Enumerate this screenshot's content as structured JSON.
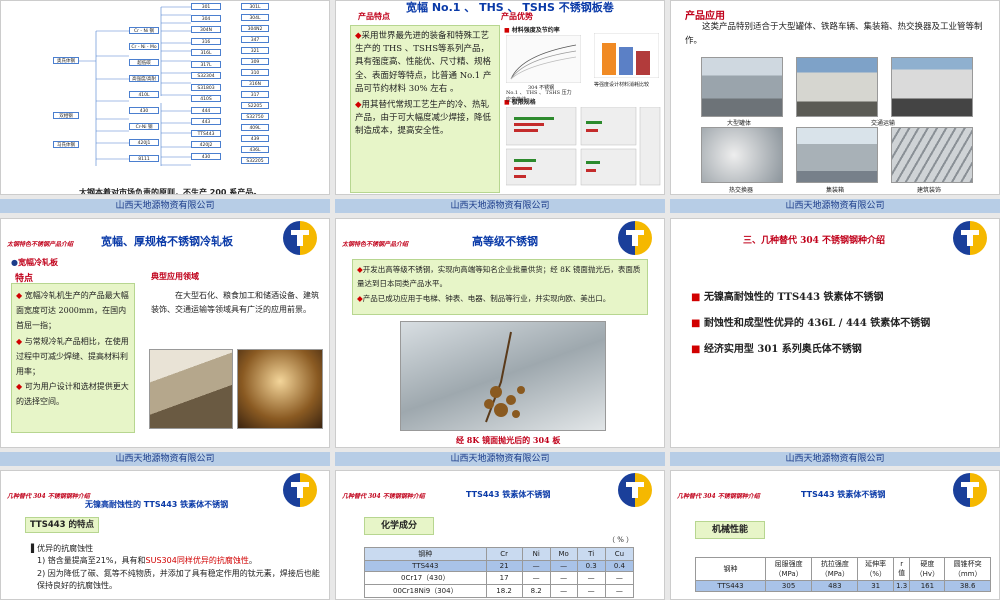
{
  "footer_text": "山西天地源物资有限公司",
  "s1": {
    "caption": "太钢本着对市场负责的原则，不生产 200 系产品。",
    "tree_left": [
      "奥氏体钢",
      "双相钢",
      "马氏体钢"
    ],
    "tree_mid": [
      "Cr - Ni 钢",
      "Cr - Ni - Mo 钢",
      "超低碳",
      "高强度/高耐蚀",
      "410L",
      "430",
      "Cr-Ni 钢",
      "420J1",
      "8111"
    ],
    "tree_right": [
      "301",
      "304",
      "304N",
      "316",
      "316L",
      "317L",
      "S32304",
      "S31803",
      "410S",
      "444",
      "443",
      "TTS443",
      "420J2",
      "430"
    ],
    "tree_far": [
      "301L",
      "304L",
      "304N2",
      "347",
      "321",
      "309",
      "310",
      "316N",
      "317",
      "S2205",
      "S32750",
      "409L",
      "439",
      "436L",
      "S32205"
    ]
  },
  "s2": {
    "title": "宽幅 No.1 、 THS 、 TSHS 不锈钢板卷",
    "tag": "产品特点",
    "adv_label": "产品优势",
    "bullets": [
      "采用世界最先进的装备和特殊工艺生产的 THS 、TSHS等系列产品，具有强度高、性能优、尺寸精、规格全、表面好等特点，比普通 No.1 产品可节约材料 30% 左右 。",
      "用其替代常规工艺生产的冷、热轧产品，由于可大幅度减少焊接，降低制造成本，提高安全性。"
    ],
    "chart1_title": "材料强度及节约率",
    "chart1_cap": "304 不锈钢",
    "chart2_cap": "等强度设计材料消耗比较",
    "chart3_title": "极限规格",
    "chart3_cap": "No.1 、 THS 、 TSHS 压力应变曲线"
  },
  "s3": {
    "title": "产品应用",
    "text": "这类产品特别适合于大型罐体、铁路车辆、集装箱、热交换器及工业管等制作。",
    "captions": [
      "大型罐体",
      "交通运输",
      "",
      "热交换器",
      "集装箱",
      "建筑装饰"
    ]
  },
  "s4": {
    "tag": "太钢特色不锈钢产品介绍",
    "title": "宽幅、厚规格不锈钢冷轧板",
    "sub": "宽幅冷轧板",
    "left_head": "特点",
    "right_head": "典型应用领域",
    "points": [
      "宽幅冷轧机生产的产品最大幅面宽度可达 2000mm，在国内首屈一指；",
      "与常规冷轧产品相比，在使用过程中可减少焊缝、提高材料利用率；",
      "可为用户设计和选材提供更大的选择空间。"
    ],
    "apps": "在大型石化、粮食加工和储酒设备、建筑装饰、交通运输等领域具有广泛的应用前景。"
  },
  "s5": {
    "tag": "太钢特色不锈钢产品介绍",
    "title": "高等级不锈钢",
    "bullets": [
      "开发出高等级不锈钢，实现向高端等知名企业批量供货；经 8K 镜面抛光后，表面质量达到日本同类产品水平。",
      "产品已成功应用于电梯、钟表、电器、制品等行业，并实现向欧、美出口。"
    ],
    "caption": "经 8K 镜面抛光后的 304 板"
  },
  "s6": {
    "title": "三、几种替代 304 不锈钢钢种介绍",
    "items": [
      "无镍高耐蚀性的 TTS443 铁素体不锈钢",
      "耐蚀性和成型性优异的 436L / 444 铁素体不锈钢",
      "经济实用型 301 系列奥氏体不锈钢"
    ]
  },
  "s7": {
    "tag": "几种替代 304 不锈钢钢种介绍",
    "title": "无镍高耐蚀性的 TTS443 铁素体不锈钢",
    "box": "TTS443 的特点",
    "head": "优异的抗腐蚀性",
    "line1a": "1) 铬含量提高至21%，具有和",
    "line1b": "SUS304同样优异的抗腐蚀性",
    "line1c": "。",
    "line2": "2) 因为降低了碳、氮等不纯物质，并添加了具有稳定作用的钛元素，焊接后也能保持良好的抗腐蚀性。"
  },
  "s8": {
    "tag": "几种替代 304 不锈钢钢种介绍",
    "title": "TTS443 铁素体不锈钢",
    "box": "化学成分",
    "unit": "（ % ）",
    "headers": [
      "钢种",
      "Cr",
      "Ni",
      "Mo",
      "Ti",
      "Cu"
    ],
    "rows": [
      [
        "TTS443",
        "21",
        "—",
        "—",
        "0.3",
        "0.4"
      ],
      [
        "0Cr17（430）",
        "17",
        "—",
        "—",
        "—",
        "—"
      ],
      [
        "00Cr18Ni9（304）",
        "18.2",
        "8.2",
        "—",
        "—",
        "—"
      ]
    ]
  },
  "s9": {
    "tag": "几种替代 304 不锈钢钢种介绍",
    "title": "TTS443 铁素体不锈钢",
    "box": "机械性能",
    "headers": [
      "钢种",
      "屈服强度（MPa）",
      "抗拉强度（MPa）",
      "延伸率（%）",
      "r 值",
      "硬度（Hv）",
      "圆锥杯突（mm）"
    ],
    "rows": [
      [
        "TTS443",
        "305",
        "483",
        "31",
        "1.3",
        "161",
        "38.6"
      ]
    ]
  }
}
